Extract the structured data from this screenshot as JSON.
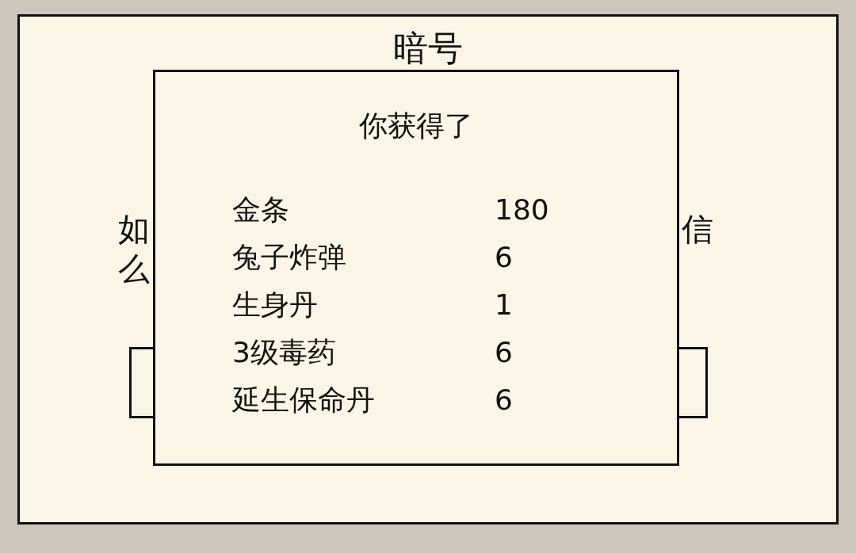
{
  "screen": {
    "title": "暗号",
    "text_lines_left": [
      "如",
      "么"
    ],
    "text_lines_right": [
      "信"
    ]
  },
  "dialog": {
    "title": "你获得了",
    "items": [
      {
        "name": "金条",
        "count": "180"
      },
      {
        "name": "兔子炸弹",
        "count": "6"
      },
      {
        "name": "生身丹",
        "count": "1"
      },
      {
        "name": "3级毒药",
        "count": "6"
      },
      {
        "name": "延生保命丹",
        "count": "6"
      }
    ]
  }
}
